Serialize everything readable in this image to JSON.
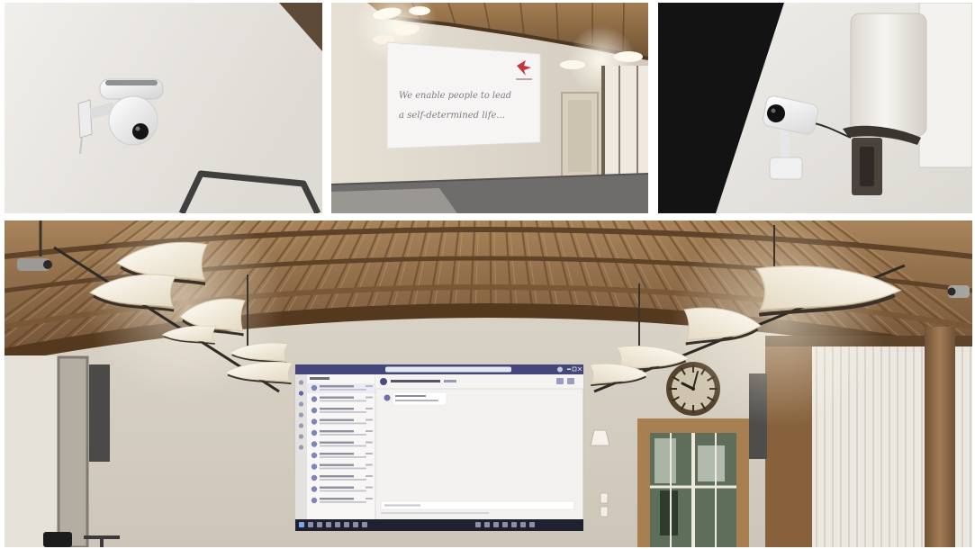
{
  "slide": {
    "line1": "We enable people to lead",
    "line2": "a self-determined life..."
  },
  "colors": {
    "wall": "#ddd6cb",
    "ceiling_wood": "#8c6a44",
    "slide_logo": "#c8323c",
    "teams_title_bar": "#45467a",
    "teams_accent": "#6264a7"
  },
  "icons": {
    "slide_logo": "logo-mark-icon",
    "clock": "wall-clock-icon"
  }
}
